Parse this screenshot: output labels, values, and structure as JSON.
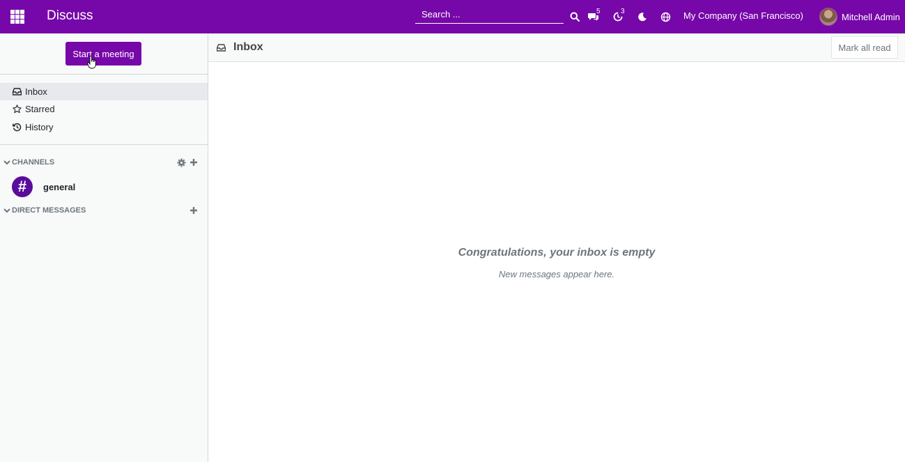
{
  "navbar": {
    "app_title": "Discuss",
    "search_placeholder": "Search ...",
    "messages_badge": "5",
    "activities_badge": "3",
    "company": "My Company (San Francisco)",
    "user_name": "Mitchell Admin",
    "bg_color": "#7607a8"
  },
  "sidebar": {
    "meeting_button": "Start a meeting",
    "mailboxes": [
      {
        "label": "Inbox",
        "icon": "inbox-icon",
        "active": true
      },
      {
        "label": "Starred",
        "icon": "star-icon",
        "active": false
      },
      {
        "label": "History",
        "icon": "history-icon",
        "active": false
      }
    ],
    "channels_header": "CHANNELS",
    "channels": [
      {
        "name": "general",
        "avatar": "#"
      }
    ],
    "direct_messages_header": "DIRECT MESSAGES"
  },
  "main": {
    "title": "Inbox",
    "mark_all_read": "Mark all read",
    "empty_title": "Congratulations, your inbox is empty",
    "empty_subtitle": "New messages appear here."
  }
}
